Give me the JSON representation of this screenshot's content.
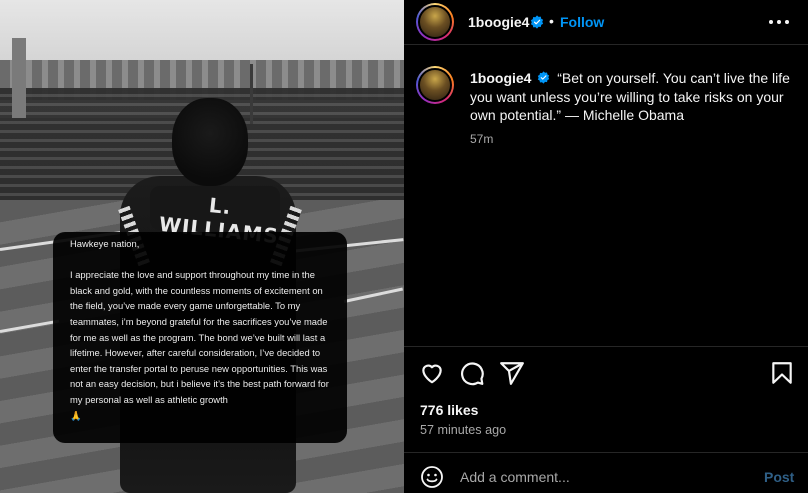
{
  "post": {
    "author": "1boogie4",
    "follow_label": "Follow",
    "separator": "•",
    "caption": "“Bet on yourself. You can’t live the life you want unless you’re willing to take risks on your own potential.” — Michelle Obama",
    "caption_time": "57m",
    "likes": "776 likes",
    "posted_ago": "57 minutes ago"
  },
  "media": {
    "jersey_name": "L. WILLIAMS",
    "note_greeting": "Hawkeye nation,",
    "note_body": "I appreciate the love and support throughout my time in the black and gold, with the countless moments of excitement on the field, you’ve made every game unforgettable. To my teammates, i’m beyond grateful for the sacrifices you’ve made for me as well as the program. The bond we’ve built will last a lifetime. However, after careful consideration, I’ve decided to enter the transfer portal to peruse new opportunities. This was not an easy decision, but i believe it’s the best path forward for my personal as well as athletic growth",
    "note_emoji": "🙏"
  },
  "comment": {
    "placeholder": "Add a comment...",
    "post_label": "Post"
  },
  "icons": {
    "verified": "verified-badge-icon",
    "more": "more-options-icon",
    "like": "heart-icon",
    "comment": "comment-icon",
    "share": "share-icon",
    "save": "bookmark-icon",
    "emoji": "emoji-icon"
  },
  "colors": {
    "background": "#000000",
    "text": "#f5f5f5",
    "muted": "#a8a8a8",
    "link": "#0095f6",
    "verified": "#0095f6",
    "divider": "#262626",
    "post_button": "#2f5f86"
  }
}
